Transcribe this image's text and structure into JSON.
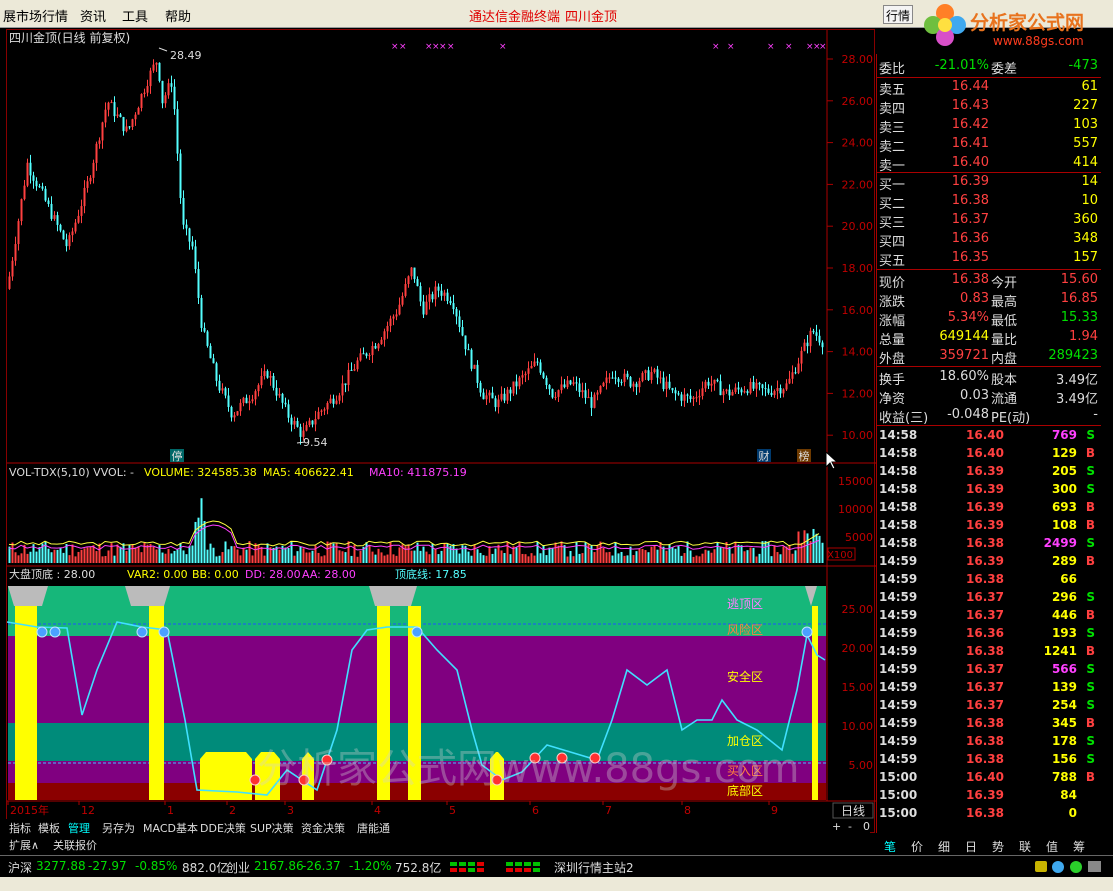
{
  "menu": {
    "items": [
      "展市场行情",
      "资讯",
      "工具",
      "帮助"
    ],
    "center_a": "通达信金融终端",
    "center_b": "四川金顶",
    "btn": "行情"
  },
  "watermark": {
    "name": "分析家公式网",
    "url": "www.88gs.com",
    "overlay": "分析家公式网www.88gs.com"
  },
  "title": "四川金顶(日线 前复权)",
  "price_axis": [
    "28.00",
    "26.00",
    "24.00",
    "22.00",
    "20.00",
    "18.00",
    "16.00",
    "14.00",
    "12.00",
    "10.00"
  ],
  "price_marks": {
    "high": "28.49",
    "low": "9.54"
  },
  "badges": {
    "ting": "停",
    "cai": "财",
    "bang": "榜"
  },
  "vol": {
    "header_a": "VOL-TDX(5,10) VVOL: -",
    "header_b": "VOLUME: 324585.38",
    "header_c": "MA5: 406622.41",
    "header_d": "MA10: 411875.19",
    "axis": [
      "15000",
      "10000",
      "5000"
    ],
    "unit": "X100"
  },
  "ind": {
    "title": "大盘顶底 : 28.00",
    "var2": "VAR2: 0.00",
    "bb": "BB: 0.00",
    "dd": "DD: 28.00",
    "aa": "AA: 28.00",
    "dxx": "顶底线: 17.85",
    "axis": [
      "25.00",
      "20.00",
      "15.00",
      "10.00",
      "5.00"
    ],
    "zones": {
      "top": "逃顶区",
      "risk": "风险区",
      "safe": "安全区",
      "add": "加仓区",
      "buy": "买入区",
      "bottom": "底部区"
    }
  },
  "time_axis": {
    "labels": [
      "2015年",
      "12",
      "1",
      "2",
      "3",
      "4",
      "5",
      "6",
      "7",
      "8",
      "9"
    ],
    "period": "日线"
  },
  "tabs": [
    "指标",
    "模板",
    "管理",
    "另存为",
    "MACD基本",
    "DDE决策",
    "SUP决策",
    "资金决策",
    "唐能通"
  ],
  "ext": [
    "扩展∧",
    "关联报价"
  ],
  "zoom": [
    "+",
    "-",
    "0"
  ],
  "colors": {
    "up": "#ff4040",
    "down": "#54ffff",
    "green": "#00e000",
    "yellow": "#ffff00",
    "magenta": "#ff40ff",
    "zone_green": "#16b77a",
    "zone_purple": "#800080",
    "zone_teal": "#008b7a"
  },
  "quote": {
    "wb": {
      "l1": "委比",
      "v1": "-21.01%",
      "l2": "委差",
      "v2": "-473"
    },
    "sell": [
      {
        "l": "卖五",
        "p": "16.44",
        "v": "61"
      },
      {
        "l": "卖四",
        "p": "16.43",
        "v": "227"
      },
      {
        "l": "卖三",
        "p": "16.42",
        "v": "103"
      },
      {
        "l": "卖二",
        "p": "16.41",
        "v": "557"
      },
      {
        "l": "卖一",
        "p": "16.40",
        "v": "414"
      }
    ],
    "buy": [
      {
        "l": "买一",
        "p": "16.39",
        "v": "14"
      },
      {
        "l": "买二",
        "p": "16.38",
        "v": "10"
      },
      {
        "l": "买三",
        "p": "16.37",
        "v": "360"
      },
      {
        "l": "买四",
        "p": "16.36",
        "v": "348"
      },
      {
        "l": "买五",
        "p": "16.35",
        "v": "157"
      }
    ],
    "stats": [
      {
        "l1": "现价",
        "v1": "16.38",
        "l2": "今开",
        "v2": "15.60",
        "c1": "#ff4040",
        "c2": "#ff4040"
      },
      {
        "l1": "涨跌",
        "v1": "0.83",
        "l2": "最高",
        "v2": "16.85",
        "c1": "#ff4040",
        "c2": "#ff4040"
      },
      {
        "l1": "涨幅",
        "v1": "5.34%",
        "l2": "最低",
        "v2": "15.33",
        "c1": "#ff4040",
        "c2": "#00e000"
      },
      {
        "l1": "总量",
        "v1": "649144",
        "l2": "量比",
        "v2": "1.94",
        "c1": "#ffff00",
        "c2": "#ff4040"
      },
      {
        "l1": "外盘",
        "v1": "359721",
        "l2": "内盘",
        "v2": "289423",
        "c1": "#ff4040",
        "c2": "#00e000"
      }
    ],
    "fin": [
      {
        "l1": "换手",
        "v1": "18.60%",
        "l2": "股本",
        "v2": "3.49亿"
      },
      {
        "l1": "净资",
        "v1": "0.03",
        "l2": "流通",
        "v2": "3.49亿"
      },
      {
        "l1": "收益(三)",
        "v1": "-0.048",
        "l2": "PE(动)",
        "v2": "-"
      }
    ]
  },
  "ticks": [
    {
      "t": "14:58",
      "p": "16.40",
      "v": "769",
      "s": "S"
    },
    {
      "t": "14:58",
      "p": "16.40",
      "v": "129",
      "s": "B"
    },
    {
      "t": "14:58",
      "p": "16.39",
      "v": "205",
      "s": "S"
    },
    {
      "t": "14:58",
      "p": "16.39",
      "v": "300",
      "s": "S"
    },
    {
      "t": "14:58",
      "p": "16.39",
      "v": "693",
      "s": "B"
    },
    {
      "t": "14:58",
      "p": "16.39",
      "v": "108",
      "s": "B"
    },
    {
      "t": "14:58",
      "p": "16.38",
      "v": "2499",
      "s": "S"
    },
    {
      "t": "14:59",
      "p": "16.39",
      "v": "289",
      "s": "B"
    },
    {
      "t": "14:59",
      "p": "16.38",
      "v": "66",
      "s": ""
    },
    {
      "t": "14:59",
      "p": "16.37",
      "v": "296",
      "s": "S"
    },
    {
      "t": "14:59",
      "p": "16.37",
      "v": "446",
      "s": "B"
    },
    {
      "t": "14:59",
      "p": "16.36",
      "v": "193",
      "s": "S"
    },
    {
      "t": "14:59",
      "p": "16.38",
      "v": "1241",
      "s": "B"
    },
    {
      "t": "14:59",
      "p": "16.37",
      "v": "566",
      "s": "S"
    },
    {
      "t": "14:59",
      "p": "16.37",
      "v": "139",
      "s": "S"
    },
    {
      "t": "14:59",
      "p": "16.37",
      "v": "254",
      "s": "S"
    },
    {
      "t": "14:59",
      "p": "16.38",
      "v": "345",
      "s": "B"
    },
    {
      "t": "14:59",
      "p": "16.38",
      "v": "178",
      "s": "S"
    },
    {
      "t": "14:59",
      "p": "16.38",
      "v": "156",
      "s": "S"
    },
    {
      "t": "15:00",
      "p": "16.40",
      "v": "788",
      "s": "B"
    },
    {
      "t": "15:00",
      "p": "16.39",
      "v": "84",
      "s": ""
    },
    {
      "t": "15:00",
      "p": "16.38",
      "v": "0",
      "s": ""
    }
  ],
  "right_tabs": [
    "笔",
    "价",
    "细",
    "日",
    "势",
    "联",
    "值",
    "筹"
  ],
  "status": {
    "sh": "沪深",
    "sh_v": "3277.88",
    "sh_c": "-27.97",
    "sh_p": "-0.85%",
    "sh_a": "882.0亿",
    "cy": "创业",
    "cy_v": "2167.86",
    "cy_c": "-26.37",
    "cy_p": "-1.20%",
    "cy_a": "752.8亿",
    "server": "深圳行情主站2"
  }
}
